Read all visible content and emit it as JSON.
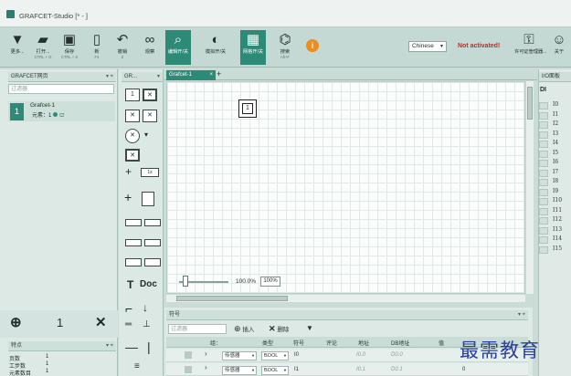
{
  "window": {
    "title": "GRAFCET-Studio [* - ]"
  },
  "ribbon": {
    "buttons": [
      {
        "label": "更多...",
        "shortcut": "",
        "icon": "caret-down-icon",
        "glyph": "▼"
      },
      {
        "label": "打开...",
        "shortcut": "CTRL + O",
        "icon": "folder-open-icon",
        "glyph": "▰"
      },
      {
        "label": "保存",
        "shortcut": "CTRL + S",
        "icon": "save-icon",
        "glyph": "▣"
      },
      {
        "label": "新",
        "shortcut": "F4",
        "icon": "new-document-icon",
        "glyph": "▯"
      },
      {
        "label": "撤销",
        "shortcut": "Z",
        "icon": "undo-icon",
        "glyph": "↶"
      },
      {
        "label": "观察",
        "shortcut": "",
        "icon": "glasses-icon",
        "glyph": "∞"
      },
      {
        "label": "编辑开/关",
        "shortcut": "",
        "icon": "magnifier-icon",
        "glyph": "⌕",
        "active": true
      },
      {
        "label": "模拟开/关",
        "shortcut": "",
        "icon": "simulate-icon",
        "glyph": "◐"
      },
      {
        "label": "网格开/关",
        "shortcut": "",
        "icon": "grid-icon",
        "glyph": "▦",
        "active": true
      },
      {
        "label": "搜索",
        "shortcut": "Alt+F",
        "icon": "binoculars-icon",
        "glyph": "⌬"
      }
    ],
    "language": "Chinese",
    "activation": "Not activated!",
    "license_label": "许可证管理器...",
    "more_label": "关于"
  },
  "left_panel": {
    "header": "GRAFCET网页",
    "filter_placeholder": "过滤器",
    "item": {
      "number": "1",
      "name": "Grafcet-1",
      "sub": "元素：1"
    },
    "add_symbol": "⊕",
    "count": "1",
    "delete_symbol": "✕",
    "props_header": "特点",
    "props": [
      {
        "key": "页数",
        "value": "1"
      },
      {
        "key": "工步数",
        "value": "1"
      },
      {
        "key": "元素数目",
        "value": "1"
      }
    ]
  },
  "palette": {
    "header": "GR...",
    "step_label": "1",
    "doc_label": "Doc",
    "text_label": "T",
    "delay_label": "1s"
  },
  "editor": {
    "tab_label": "Grafcet-1",
    "step_number": "1",
    "zoom_text": "100.0%",
    "zoom_button": "100%"
  },
  "symbols": {
    "header": "符号",
    "filter_placeholder": "过滤器",
    "insert_label": "插入",
    "delete_label": "删除",
    "columns": [
      "组：",
      "类型",
      "符号",
      "评论",
      "地址",
      "DB地址",
      "值"
    ],
    "rows": [
      {
        "kind": "传感器",
        "type": "BOOL",
        "symbol": "I0",
        "addr": "I0.0",
        "db": "D0.0",
        "value": ""
      },
      {
        "kind": "传感器",
        "type": "BOOL",
        "symbol": "I1",
        "addr": "I0.1",
        "db": "D0.1",
        "value": "0"
      }
    ]
  },
  "io_panel": {
    "header": "I/O面板",
    "section": "DI",
    "inputs": [
      "I0",
      "I1",
      "I2",
      "I3",
      "I4",
      "I5",
      "I6",
      "I7",
      "I8",
      "I9",
      "I10",
      "I11",
      "I12",
      "I13",
      "I14",
      "I15"
    ]
  },
  "watermark": "最需教育"
}
